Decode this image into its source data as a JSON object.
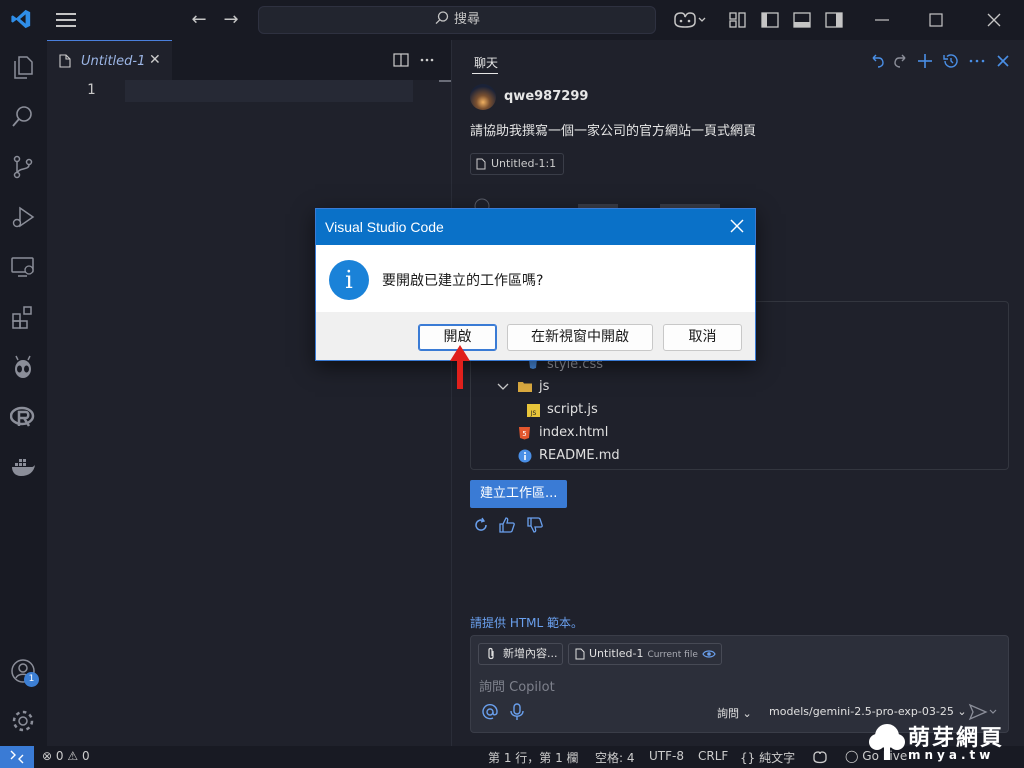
{
  "titlebar": {
    "search_placeholder": "搜尋"
  },
  "editor": {
    "tab_label": "Untitled-1",
    "line_number": "1"
  },
  "chat": {
    "tab_label": "聊天",
    "username": "qwe987299",
    "user_message": "請協助我撰寫一個一家公司的官方網站一頁式網頁",
    "reference_chip": "Untitled-1:1",
    "tree": [
      {
        "name": "style.css",
        "type": "css"
      },
      {
        "name": "js",
        "type": "folder"
      },
      {
        "name": "script.js",
        "type": "js"
      },
      {
        "name": "index.html",
        "type": "html"
      },
      {
        "name": "README.md",
        "type": "info"
      }
    ],
    "create_workspace_button": "建立工作區...",
    "suggestion": "請提供 HTML 範本。",
    "input": {
      "attach_chip": "新增內容...",
      "file_chip": "Untitled-1",
      "file_chip_sub": "Current file",
      "placeholder": "詢問 Copilot",
      "mode_select": "詢問",
      "model_select": "models/gemini-2.5-pro-exp-03-25"
    }
  },
  "dialog": {
    "title": "Visual Studio Code",
    "message": "要開啟已建立的工作區嗎?",
    "buttons": {
      "open": "開啟",
      "open_new_window": "在新視窗中開啟",
      "cancel": "取消"
    }
  },
  "statusbar": {
    "errors": "0",
    "warnings": "0",
    "position": "第 1 行，第 1 欄",
    "spaces": "空格: 4",
    "encoding": "UTF-8",
    "eol": "CRLF",
    "language": "純文字",
    "golive": "Go Live"
  },
  "activity_badge": "1",
  "watermark": {
    "cn": "萌芽網頁",
    "en": "mnya.tw"
  },
  "colors": {
    "accent": "#3a7bd5",
    "dialog_title": "#0a71c8",
    "arrow": "#e0201c"
  }
}
